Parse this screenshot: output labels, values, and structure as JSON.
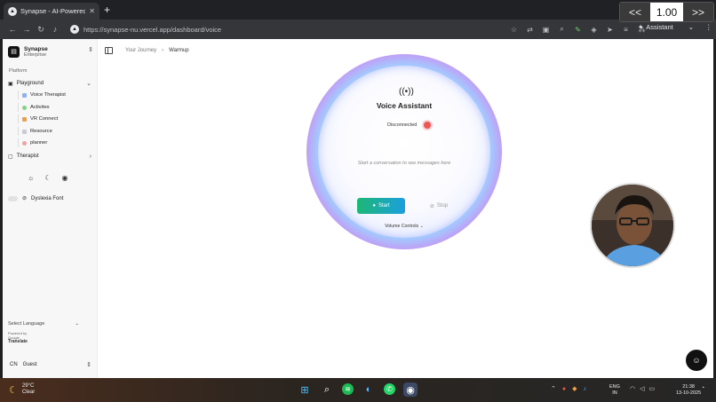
{
  "browser": {
    "tab_title": "Synapse - AI-Powered Learni",
    "new_tab": "+",
    "url": "https://synapse-nu.vercel.app/dashboard/voice",
    "assistant_label": "Assistant"
  },
  "zoom": {
    "prev": "<<",
    "value": "1.00",
    "next": ">>"
  },
  "sidebar": {
    "org_name": "Synapse",
    "org_plan": "Enterprise",
    "section": "Platform",
    "playground": "Playground",
    "items": [
      {
        "label": "Voice Therapist",
        "color": "#8ab4f8"
      },
      {
        "label": "Activites",
        "color": "#7ed67e"
      },
      {
        "label": "VR Connect",
        "color": "#f0a040"
      },
      {
        "label": "Resource",
        "color": "#c9c9d9"
      },
      {
        "label": "planner",
        "color": "#f2a0a0"
      }
    ],
    "therapist": "Therapist",
    "dyslexia_font": "Dyslexia Font",
    "select_language": "Select Language",
    "powered_by": "Powered by",
    "google": "Google",
    "translate": "Translate",
    "user_initials": "CN",
    "user_name": "Guest"
  },
  "breadcrumb": {
    "parent": "Your Journey",
    "current": "Warmup"
  },
  "voice": {
    "title": "Voice Assistant",
    "status": "Disconnected",
    "placeholder": "Start a conversation to see messages here",
    "start": "Start",
    "stop": "Stop",
    "volume": "Volume Controls"
  },
  "taskbar": {
    "temp": "29°C",
    "condition": "Clear",
    "lang_top": "ENG",
    "lang_bottom": "IN",
    "time": "21:38",
    "date": "13-10-2025"
  }
}
